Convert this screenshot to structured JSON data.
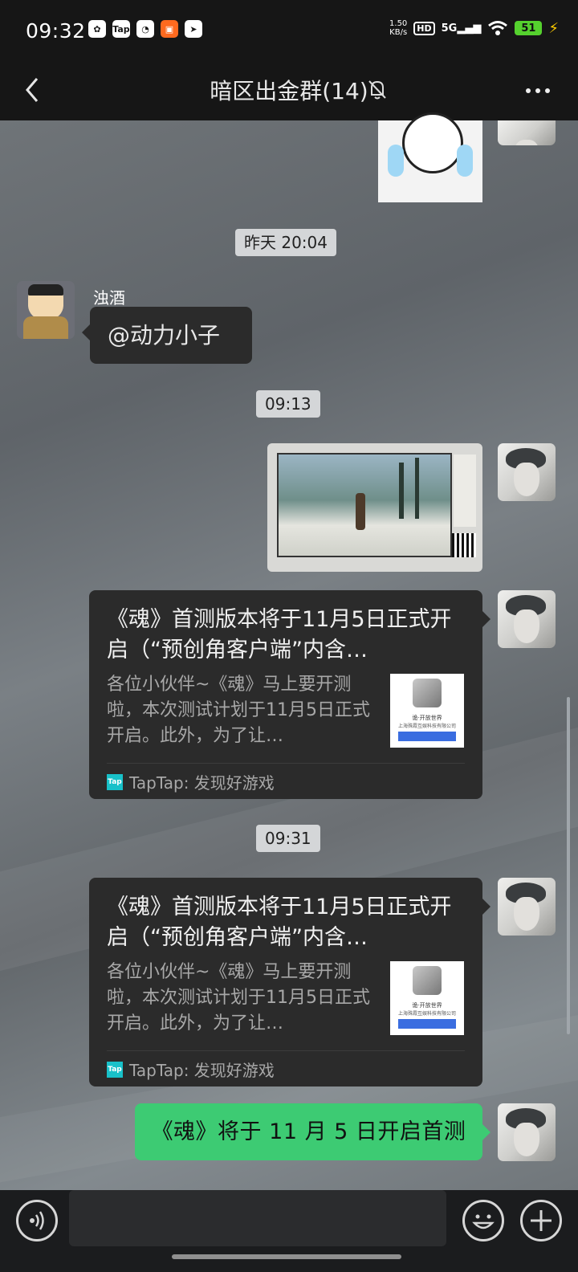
{
  "status_bar": {
    "time": "09:32",
    "app_icons": [
      "qq-icon",
      "taptap-icon",
      "speed-icon",
      "orange-app-icon",
      "send-app-icon"
    ],
    "taptap_label": "Tap",
    "net_speed_value": "1.50",
    "net_speed_unit": "KB/s",
    "hd_label": "HD",
    "network": "5G",
    "battery": "51"
  },
  "header": {
    "title": "暗区出金群(14)"
  },
  "messages": {
    "ts1": "昨天 20:04",
    "sender_name": "浊酒",
    "mention_text": "@动力小子",
    "ts2": "09:13",
    "ts3": "09:31",
    "green_text": "《魂》将于 11 月 5 日开启首测"
  },
  "card1": {
    "title": "《魂》首测版本将于11月5日正式开启（“预创角客户端”内含…",
    "desc": "各位小伙伴~《魂》马上要开测啦，本次测试计划于11月5日正式开启。此外，为了让…",
    "source": "TapTap: 发现好游戏",
    "source_icon": "Tap",
    "thumb_line1": "诡·开放世界",
    "thumb_line2": "上海殊霞互娱科技有限公司"
  },
  "card2": {
    "title": "《魂》首测版本将于11月5日正式开启（“预创角客户端”内含…",
    "desc": "各位小伙伴~《魂》马上要开测啦，本次测试计划于11月5日正式开启。此外，为了让…",
    "source": "TapTap: 发现好游戏",
    "source_icon": "Tap",
    "thumb_line1": "诡·开放世界",
    "thumb_line2": "上海殊霞互娱科技有限公司"
  },
  "colors": {
    "green_bubble": "#3dcb73",
    "dark_bubble": "#2b2b2b",
    "timestamp_bg": "#d4d6d8"
  }
}
